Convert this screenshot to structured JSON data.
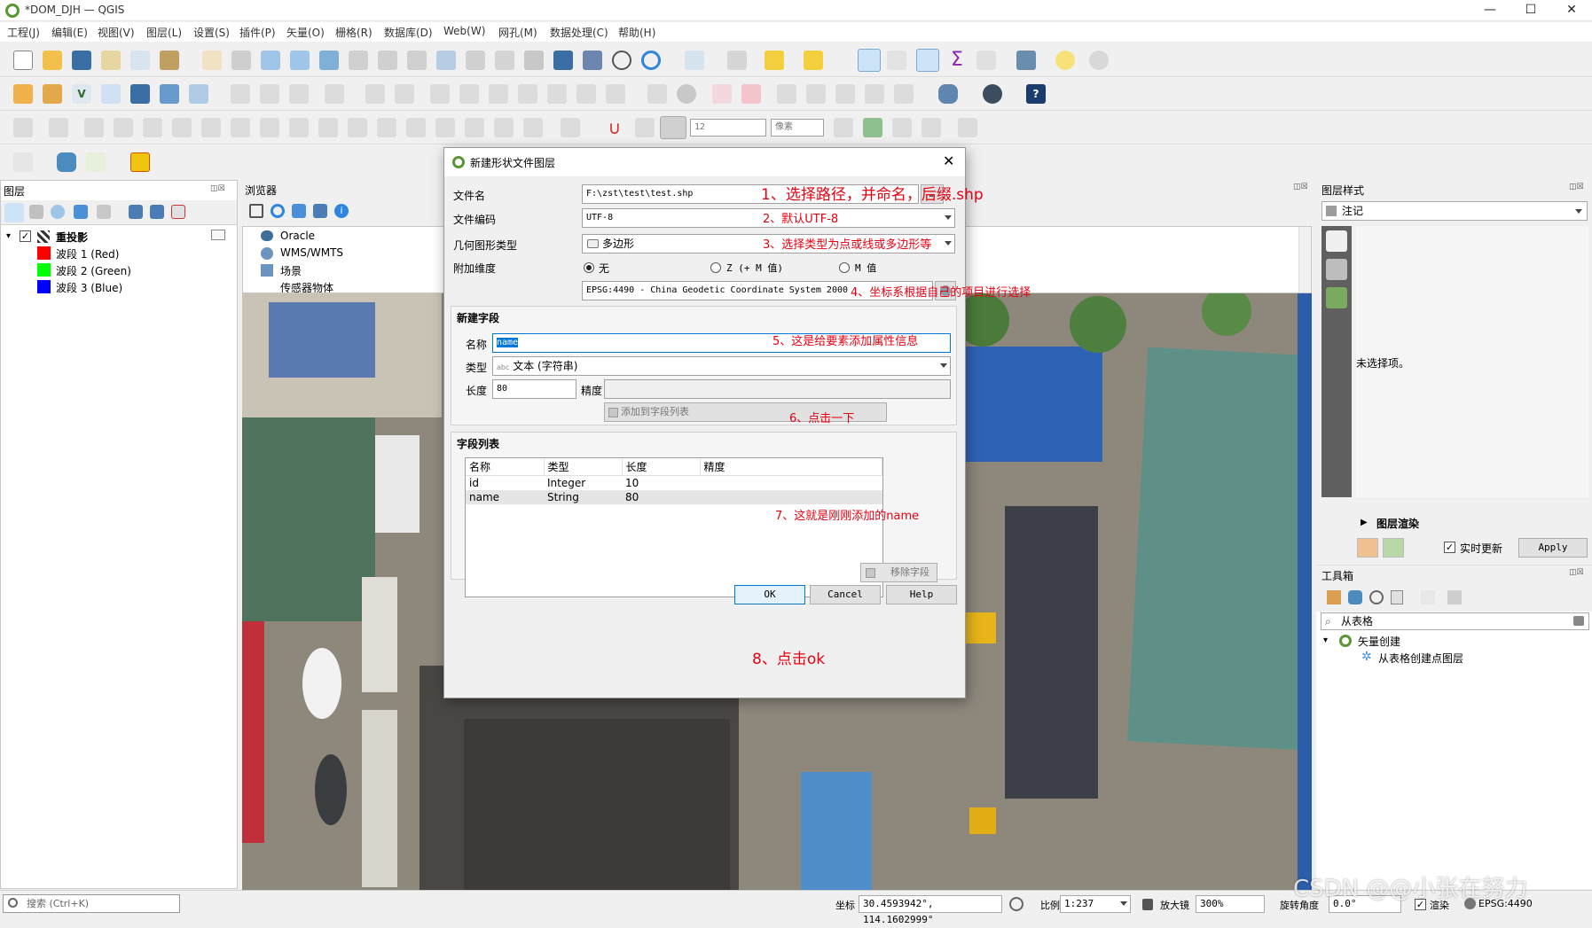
{
  "window": {
    "title": "*DOM_DJH — QGIS",
    "minimize": "—",
    "maximize": "☐",
    "close": "✕"
  },
  "menu": [
    "工程(J)",
    "编辑(E)",
    "视图(V)",
    "图层(L)",
    "设置(S)",
    "插件(P)",
    "矢量(O)",
    "栅格(R)",
    "数据库(D)",
    "Web(W)",
    "网孔(M)",
    "数据处理(C)",
    "帮助(H)"
  ],
  "toolbar": {
    "font_size_value": "12",
    "unit_value": "像素"
  },
  "layers_panel": {
    "title": "图层",
    "group": "重投影",
    "bands": [
      {
        "label": "波段 1 (Red)",
        "color": "#ff0000"
      },
      {
        "label": "波段 2 (Green)",
        "color": "#00ff00"
      },
      {
        "label": "波段 3 (Blue)",
        "color": "#0000ff"
      }
    ]
  },
  "browser_panel": {
    "title": "浏览器",
    "items": [
      "Oracle",
      "WMS/WMTS",
      "场景",
      "传感器物体"
    ]
  },
  "style_panel": {
    "title": "图层样式",
    "selected": "注记",
    "empty_text": "未选择项。",
    "render_label": "图层渲染",
    "realtime_label": "实时更新",
    "apply_label": "Apply"
  },
  "toolbox_panel": {
    "title": "工具箱",
    "search_value": "从表格",
    "group": "矢量创建",
    "tool": "从表格创建点图层"
  },
  "dialog": {
    "title": "新建形状文件图层",
    "file_label": "文件名",
    "file_value": "F:\\zst\\test\\test.shp",
    "file_btn": "…",
    "encoding_label": "文件编码",
    "encoding_value": "UTF-8",
    "geom_label": "几何图形类型",
    "geom_value": "多边形",
    "dim_label": "附加维度",
    "dim_none": "无",
    "dim_z": "Z (+ M 值)",
    "dim_m": "M 值",
    "crs_value": "EPSG:4490 - China Geodetic Coordinate System 2000",
    "new_field_title": "新建字段",
    "name_label": "名称",
    "name_value": "name",
    "type_label": "类型",
    "type_prefix": "abc",
    "type_value": "文本 (字符串)",
    "length_label": "长度",
    "length_value": "80",
    "precision_label": "精度",
    "add_field_btn": "添加到字段列表",
    "field_list_title": "字段列表",
    "columns": [
      "名称",
      "类型",
      "长度",
      "精度"
    ],
    "rows": [
      [
        "id",
        "Integer",
        "10",
        ""
      ],
      [
        "name",
        "String",
        "80",
        ""
      ]
    ],
    "remove_btn": "移除字段",
    "ok_btn": "OK",
    "cancel_btn": "Cancel",
    "help_btn": "Help"
  },
  "annotations": {
    "a1": "1、选择路径，并命名，后缀.shp",
    "a2": "2、默认UTF-8",
    "a3": "3、选择类型为点或线或多边形等",
    "a4": "4、坐标系根据自己的项目进行选择",
    "a5": "5、这是给要素添加属性信息",
    "a6": "6、点击一下",
    "a7": "7、这就是刚刚添加的name",
    "a8": "8、点击ok"
  },
  "statusbar": {
    "search_placeholder": "搜索 (Ctrl+K)",
    "coord_label": "坐标",
    "coord_value": "30.4593942°, 114.1602999°",
    "scale_label": "比例",
    "scale_value": "1:237",
    "magnifier_label": "放大镜",
    "magnifier_value": "300%",
    "rotation_label": "旋转角度",
    "rotation_value": "0.0°",
    "render_label": "渲染",
    "crs_label": "EPSG:4490"
  },
  "watermark": "CSDN @@小张在努力",
  "colors": {
    "accent": "#0078d7",
    "annotation": "#e60012",
    "qgis_green": "#589632"
  }
}
